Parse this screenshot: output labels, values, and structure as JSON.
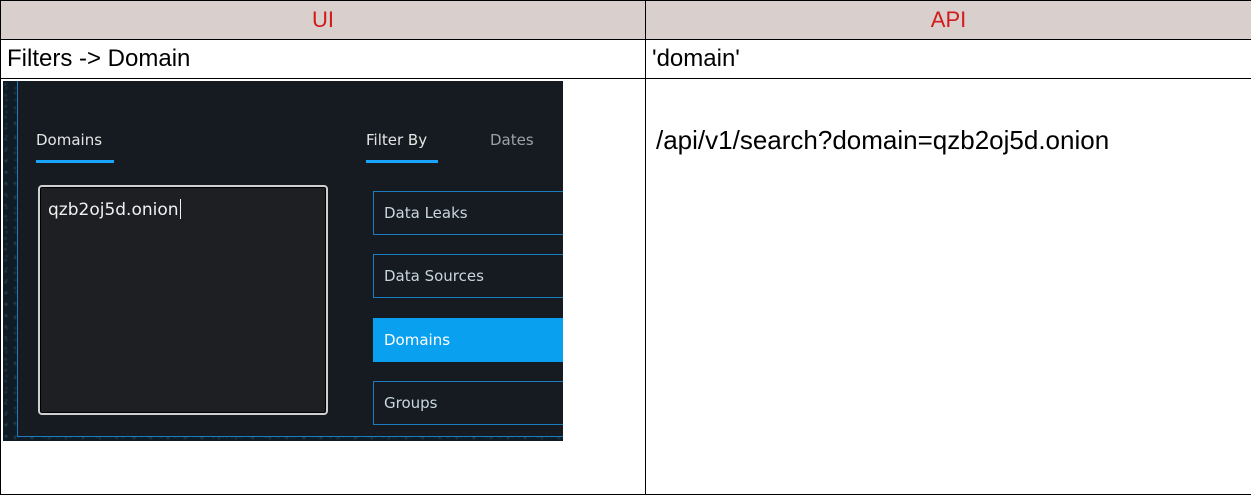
{
  "table": {
    "headers": [
      "UI",
      "API"
    ],
    "row_label_ui": "Filters -> Domain",
    "row_label_api": "'domain'",
    "api_example": "/api/v1/search?domain=qzb2oj5d.onion"
  },
  "screenshot": {
    "tabs": {
      "domains": "Domains",
      "filter_by": "Filter By",
      "dates": "Dates"
    },
    "domain_input_value": "qzb2oj5d.onion",
    "filter_buttons": [
      {
        "label": "Data Leaks",
        "active": false
      },
      {
        "label": "Data Sources",
        "active": false
      },
      {
        "label": "Domains",
        "active": true
      },
      {
        "label": "Groups",
        "active": false
      }
    ]
  },
  "colors": {
    "header_bg": "#d9cfcc",
    "header_text": "#d21a1a",
    "accent_blue": "#0aa0f0"
  }
}
